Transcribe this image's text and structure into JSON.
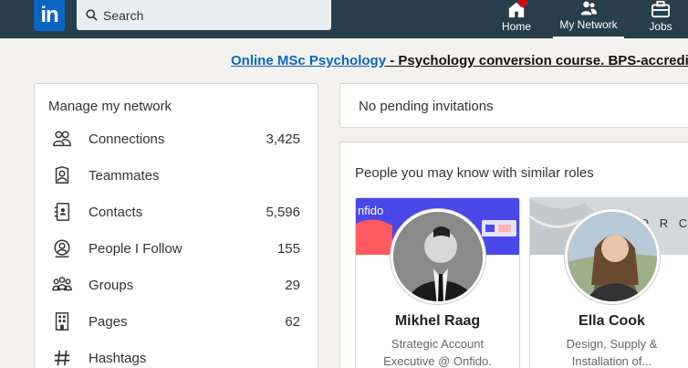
{
  "nav": {
    "logo": "in",
    "search_placeholder": "Search",
    "home_label": "Home",
    "network_label": "My Network",
    "jobs_label": "Jobs"
  },
  "ad": {
    "link": "Online MSc Psychology",
    "text": " - Psychology conversion course. BPS-accredi"
  },
  "network": {
    "title": "Manage my network",
    "items": [
      {
        "label": "Connections",
        "count": "3,425",
        "icon": "connections-icon"
      },
      {
        "label": "Teammates",
        "count": "",
        "icon": "teammates-icon"
      },
      {
        "label": "Contacts",
        "count": "5,596",
        "icon": "contacts-icon"
      },
      {
        "label": "People I Follow",
        "count": "155",
        "icon": "people-follow-icon"
      },
      {
        "label": "Groups",
        "count": "29",
        "icon": "groups-icon"
      },
      {
        "label": "Pages",
        "count": "62",
        "icon": "pages-icon"
      },
      {
        "label": "Hashtags",
        "count": "",
        "icon": "hashtag-icon"
      }
    ]
  },
  "invitations": {
    "text": "No pending invitations"
  },
  "pymk": {
    "title": "People you may know with similar roles",
    "people": [
      {
        "name": "Mikhel Raag",
        "role": "Strategic Account Executive @ Onfido.",
        "cover_text": "nfido"
      },
      {
        "name": "Ella Cook",
        "role": "Design, Supply & Installation of...",
        "cover_text": "O R C"
      }
    ]
  },
  "colors": {
    "topbar": "#283e4a",
    "brand": "#0a66c2",
    "badge": "#cc1016"
  }
}
